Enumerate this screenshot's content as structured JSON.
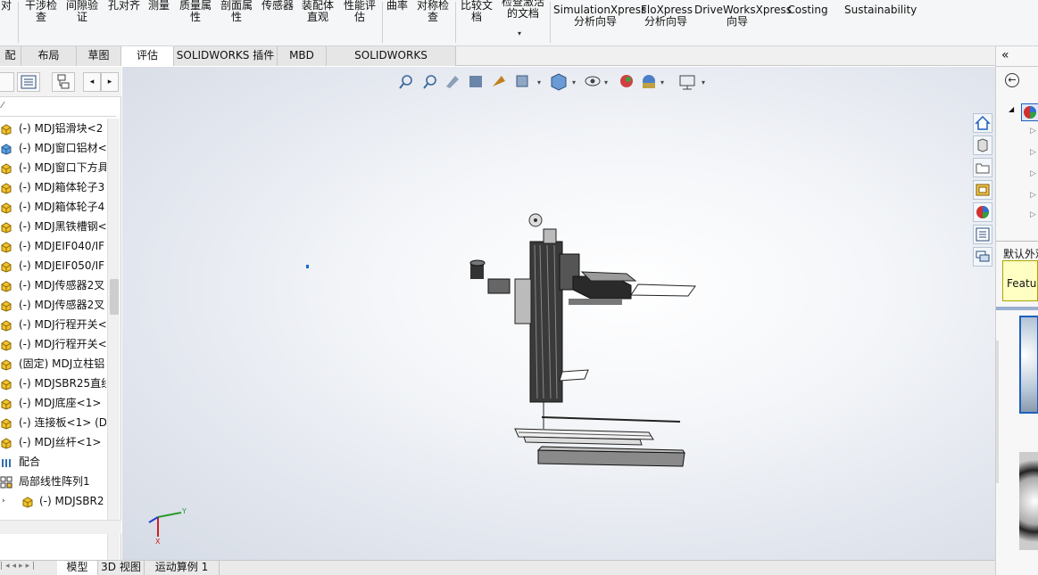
{
  "ribbon": {
    "items": [
      {
        "label": "干涉检\n查"
      },
      {
        "label": "间隙验\n证"
      },
      {
        "label": "孔对齐"
      },
      {
        "label": "测量"
      },
      {
        "label": "质量属\n性"
      },
      {
        "label": "剖面属\n性"
      },
      {
        "label": "传感器"
      },
      {
        "label": "装配体\n直观"
      },
      {
        "label": "性能评\n估"
      },
      {
        "label": "曲率"
      },
      {
        "label": "对称检\n查"
      },
      {
        "label": "比较文\n档"
      },
      {
        "label": "检查激活\n的文档"
      },
      {
        "label": "SimulationXpress\n分析向导"
      },
      {
        "label": "FloXpress\n分析向导"
      },
      {
        "label": "DriveWorksXpress\n向导"
      },
      {
        "label": "Costing"
      },
      {
        "label": "Sustainability"
      }
    ],
    "left_fragment": "对"
  },
  "tabs": [
    "配体",
    "布局",
    "草图",
    "评估",
    "SOLIDWORKS 插件",
    "MBD",
    "SOLIDWORKS Inspection"
  ],
  "active_tab": "评估",
  "tree": {
    "items": [
      {
        "label": "(-) MDJ铝滑块<2",
        "icon": "part-icon"
      },
      {
        "label": "(-) MDJ窗口铝材<",
        "icon": "part-icon"
      },
      {
        "label": "(-) MDJ窗口下方具",
        "icon": "part-icon"
      },
      {
        "label": "(-) MDJ箱体轮子3",
        "icon": "part-icon"
      },
      {
        "label": "(-) MDJ箱体轮子4",
        "icon": "part-icon"
      },
      {
        "label": "(-) MDJ黑铁槽钢<",
        "icon": "part-icon"
      },
      {
        "label": "(-) MDJEIF040/IF",
        "icon": "part-icon"
      },
      {
        "label": "(-) MDJEIF050/IF",
        "icon": "part-icon"
      },
      {
        "label": "(-) MDJ传感器2叉",
        "icon": "part-icon"
      },
      {
        "label": "(-) MDJ传感器2叉",
        "icon": "part-icon"
      },
      {
        "label": "(-) MDJ行程开关<",
        "icon": "part-icon"
      },
      {
        "label": "(-) MDJ行程开关<",
        "icon": "part-icon"
      },
      {
        "label": "(固定) MDJ立柱铝",
        "icon": "part-icon"
      },
      {
        "label": "(-) MDJSBR25直线",
        "icon": "part-icon"
      },
      {
        "label": "(-) MDJ底座<1>",
        "icon": "part-icon"
      },
      {
        "label": "(-) 连接板<1> (D",
        "icon": "part-icon"
      },
      {
        "label": "(-) MDJ丝杆<1>",
        "icon": "part-icon"
      },
      {
        "label": "配合",
        "icon": "mate-icon"
      },
      {
        "label": "局部线性阵列1",
        "icon": "pattern-icon"
      },
      {
        "label": "(-) MDJSBR2",
        "icon": "part-icon"
      }
    ]
  },
  "bottom_tabs": [
    "模型",
    "3D 视图",
    "运动算例 1"
  ],
  "active_bottom_tab": "模型",
  "triad": {
    "x_label": "X",
    "y_label": "Y"
  },
  "right_panel": {
    "default_appearance": "默认外观",
    "tooltip": "Featur"
  },
  "colors": {
    "accent_blue": "#1f5fbf",
    "tooltip_bg": "#ffffc4",
    "part_icon_yellow": "#e8b200"
  }
}
